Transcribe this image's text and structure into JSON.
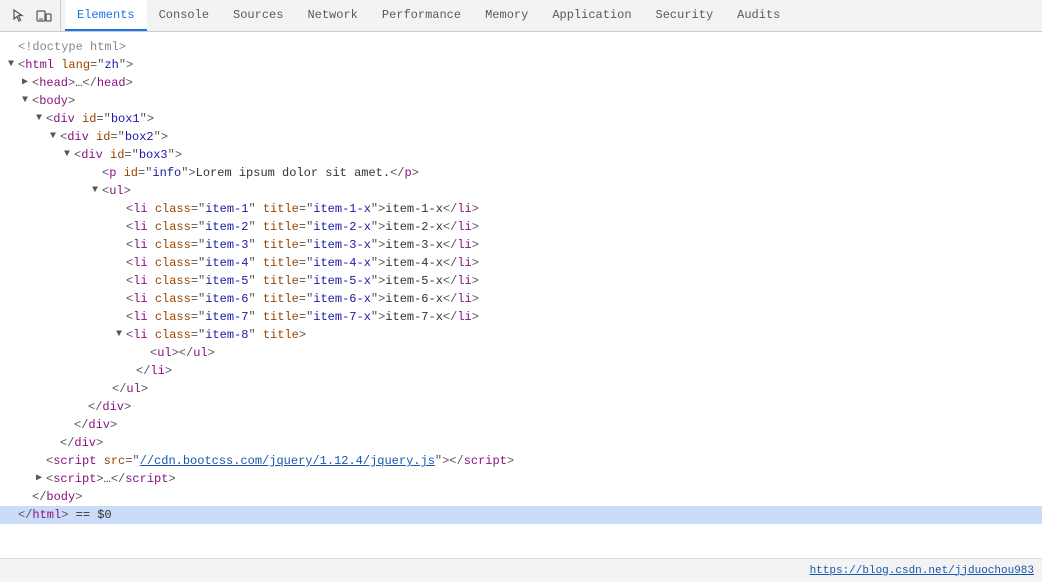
{
  "tabs": [
    {
      "label": "Elements",
      "active": true
    },
    {
      "label": "Console",
      "active": false
    },
    {
      "label": "Sources",
      "active": false
    },
    {
      "label": "Network",
      "active": false
    },
    {
      "label": "Performance",
      "active": false
    },
    {
      "label": "Memory",
      "active": false
    },
    {
      "label": "Application",
      "active": false
    },
    {
      "label": "Security",
      "active": false
    },
    {
      "label": "Audits",
      "active": false
    }
  ],
  "statusbar": {
    "left": "https://blog.csdn.net/jjduochou983",
    "right": "== $0"
  },
  "html_line": "html == $0"
}
